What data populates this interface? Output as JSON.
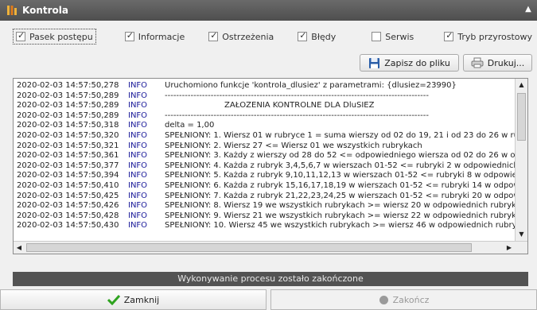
{
  "window": {
    "title": "Kontrola"
  },
  "checkboxes": [
    {
      "label": "Pasek postępu",
      "checked": true
    },
    {
      "label": "Informacje",
      "checked": true
    },
    {
      "label": "Ostrzeżenia",
      "checked": true
    },
    {
      "label": "Błędy",
      "checked": true
    },
    {
      "label": "Serwis",
      "checked": false
    },
    {
      "label": "Tryb przyrostowy",
      "checked": true
    }
  ],
  "toolbar": {
    "save_label": "Zapisz do pliku",
    "print_label": "Drukuj..."
  },
  "log": {
    "lines": [
      {
        "ts": "2020-02-03 14:57:50,278",
        "level": "INFO",
        "msg": "Uruchomiono funkcje 'kontrola_dlusiez' z parametrami: {dlusiez=23990}"
      },
      {
        "ts": "2020-02-03 14:57:50,289",
        "level": "INFO",
        "msg": "--------------------------------------------------------------------------------------------"
      },
      {
        "ts": "2020-02-03 14:57:50,289",
        "level": "INFO",
        "msg": "ZAŁOŻENIA KONTROLNE DLA DluSIEZ",
        "center": true
      },
      {
        "ts": "2020-02-03 14:57:50,289",
        "level": "INFO",
        "msg": "--------------------------------------------------------------------------------------------"
      },
      {
        "ts": "2020-02-03 14:57:50,318",
        "level": "INFO",
        "msg": "delta = 1,00"
      },
      {
        "ts": "2020-02-03 14:57:50,320",
        "level": "INFO",
        "msg": "SPEŁNIONY: 1. Wiersz 01 w rubryce 1 = suma wierszy od 02 do 19, 21 i od 23 do 26 w rub"
      },
      {
        "ts": "2020-02-03 14:57:50,321",
        "level": "INFO",
        "msg": "SPEŁNIONY: 2. Wiersz 27 <= Wiersz 01 we wszystkich rubrykach"
      },
      {
        "ts": "2020-02-03 14:57:50,361",
        "level": "INFO",
        "msg": "SPEŁNIONY: 3. Każdy z wierszy od 28 do 52 <= odpowiedniego wiersza od 02 do 26 w odp"
      },
      {
        "ts": "2020-02-03 14:57:50,377",
        "level": "INFO",
        "msg": "SPEŁNIONY: 4. Każda z rubryk 3,4,5,6,7 w wierszach 01-52 <= rubryki 2 w odpowiednich"
      },
      {
        "ts": "2020-02-03 14:57:50,394",
        "level": "INFO",
        "msg": "SPEŁNIONY: 5. Każda z rubryk 9,10,11,12,13 w wierszach 01-52 <= rubryki 8 w odpowied"
      },
      {
        "ts": "2020-02-03 14:57:50,410",
        "level": "INFO",
        "msg": "SPEŁNIONY: 6. Każda z rubryk 15,16,17,18,19 w wierszach 01-52 <= rubryki 14 w odpow"
      },
      {
        "ts": "2020-02-03 14:57:50,425",
        "level": "INFO",
        "msg": "SPEŁNIONY: 7. Każda z rubryk 21,22,23,24,25 w wierszach 01-52 <= rubryki 20 w odpowi"
      },
      {
        "ts": "2020-02-03 14:57:50,426",
        "level": "INFO",
        "msg": "SPEŁNIONY: 8. Wiersz 19 we wszystkich rubrykach >= wiersz 20 w odpowiednich rubrykac"
      },
      {
        "ts": "2020-02-03 14:57:50,428",
        "level": "INFO",
        "msg": "SPEŁNIONY: 9. Wiersz 21 we wszystkich rubrykach >= wiersz 22 w odpowiednich rubrykac"
      },
      {
        "ts": "2020-02-03 14:57:50,430",
        "level": "INFO",
        "msg": "SPEŁNIONY: 10. Wiersz 45 we wszystkich rubrykach >= wiersz 46 w odpowiednich rubrykac"
      }
    ]
  },
  "status": {
    "text": "Wykonywanie procesu zostało zakończone"
  },
  "buttons": {
    "close_label": "Zamknij",
    "finish_label": "Zakończ"
  },
  "colors": {
    "accent": "#f0b23a",
    "status_bar": "#535353",
    "level": "#1a1a9a",
    "check": "#2ea31f"
  }
}
